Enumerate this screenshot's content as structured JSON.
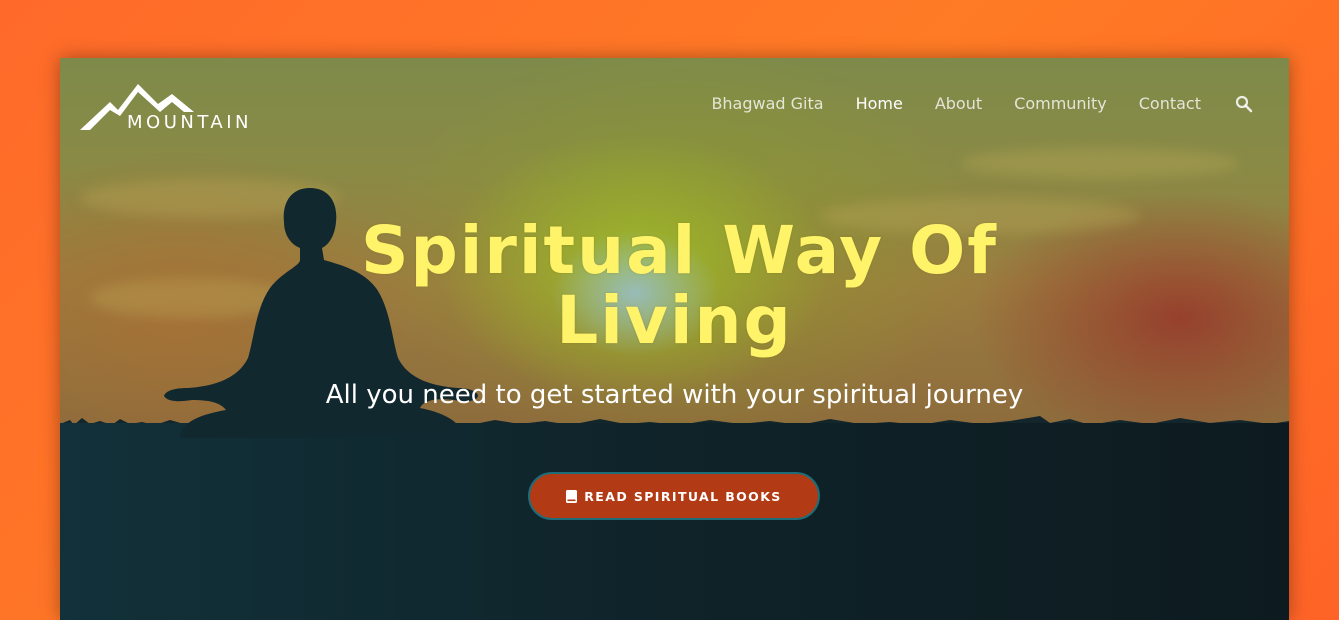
{
  "brand": {
    "logo_text": "MOUNTAIN",
    "logo_icon": "mountain-icon"
  },
  "nav": {
    "items": [
      {
        "label": "Bhagwad Gita",
        "active": false
      },
      {
        "label": "Home",
        "active": true
      },
      {
        "label": "About",
        "active": false
      },
      {
        "label": "Community",
        "active": false
      },
      {
        "label": "Contact",
        "active": false
      }
    ],
    "search_icon": "search-icon"
  },
  "hero": {
    "title_line1": "Spiritual Way Of",
    "title_line2": "Living",
    "subtitle": "All you need to get started with your spiritual journey",
    "cta_label": "READ SPIRITUAL BOOKS",
    "cta_icon": "book-icon"
  },
  "colors": {
    "page_background": "#ff6a2a",
    "title": "#fff36a",
    "cta_background": "#b23a14",
    "cta_border": "#1f6d78",
    "ground": "#12262c"
  }
}
